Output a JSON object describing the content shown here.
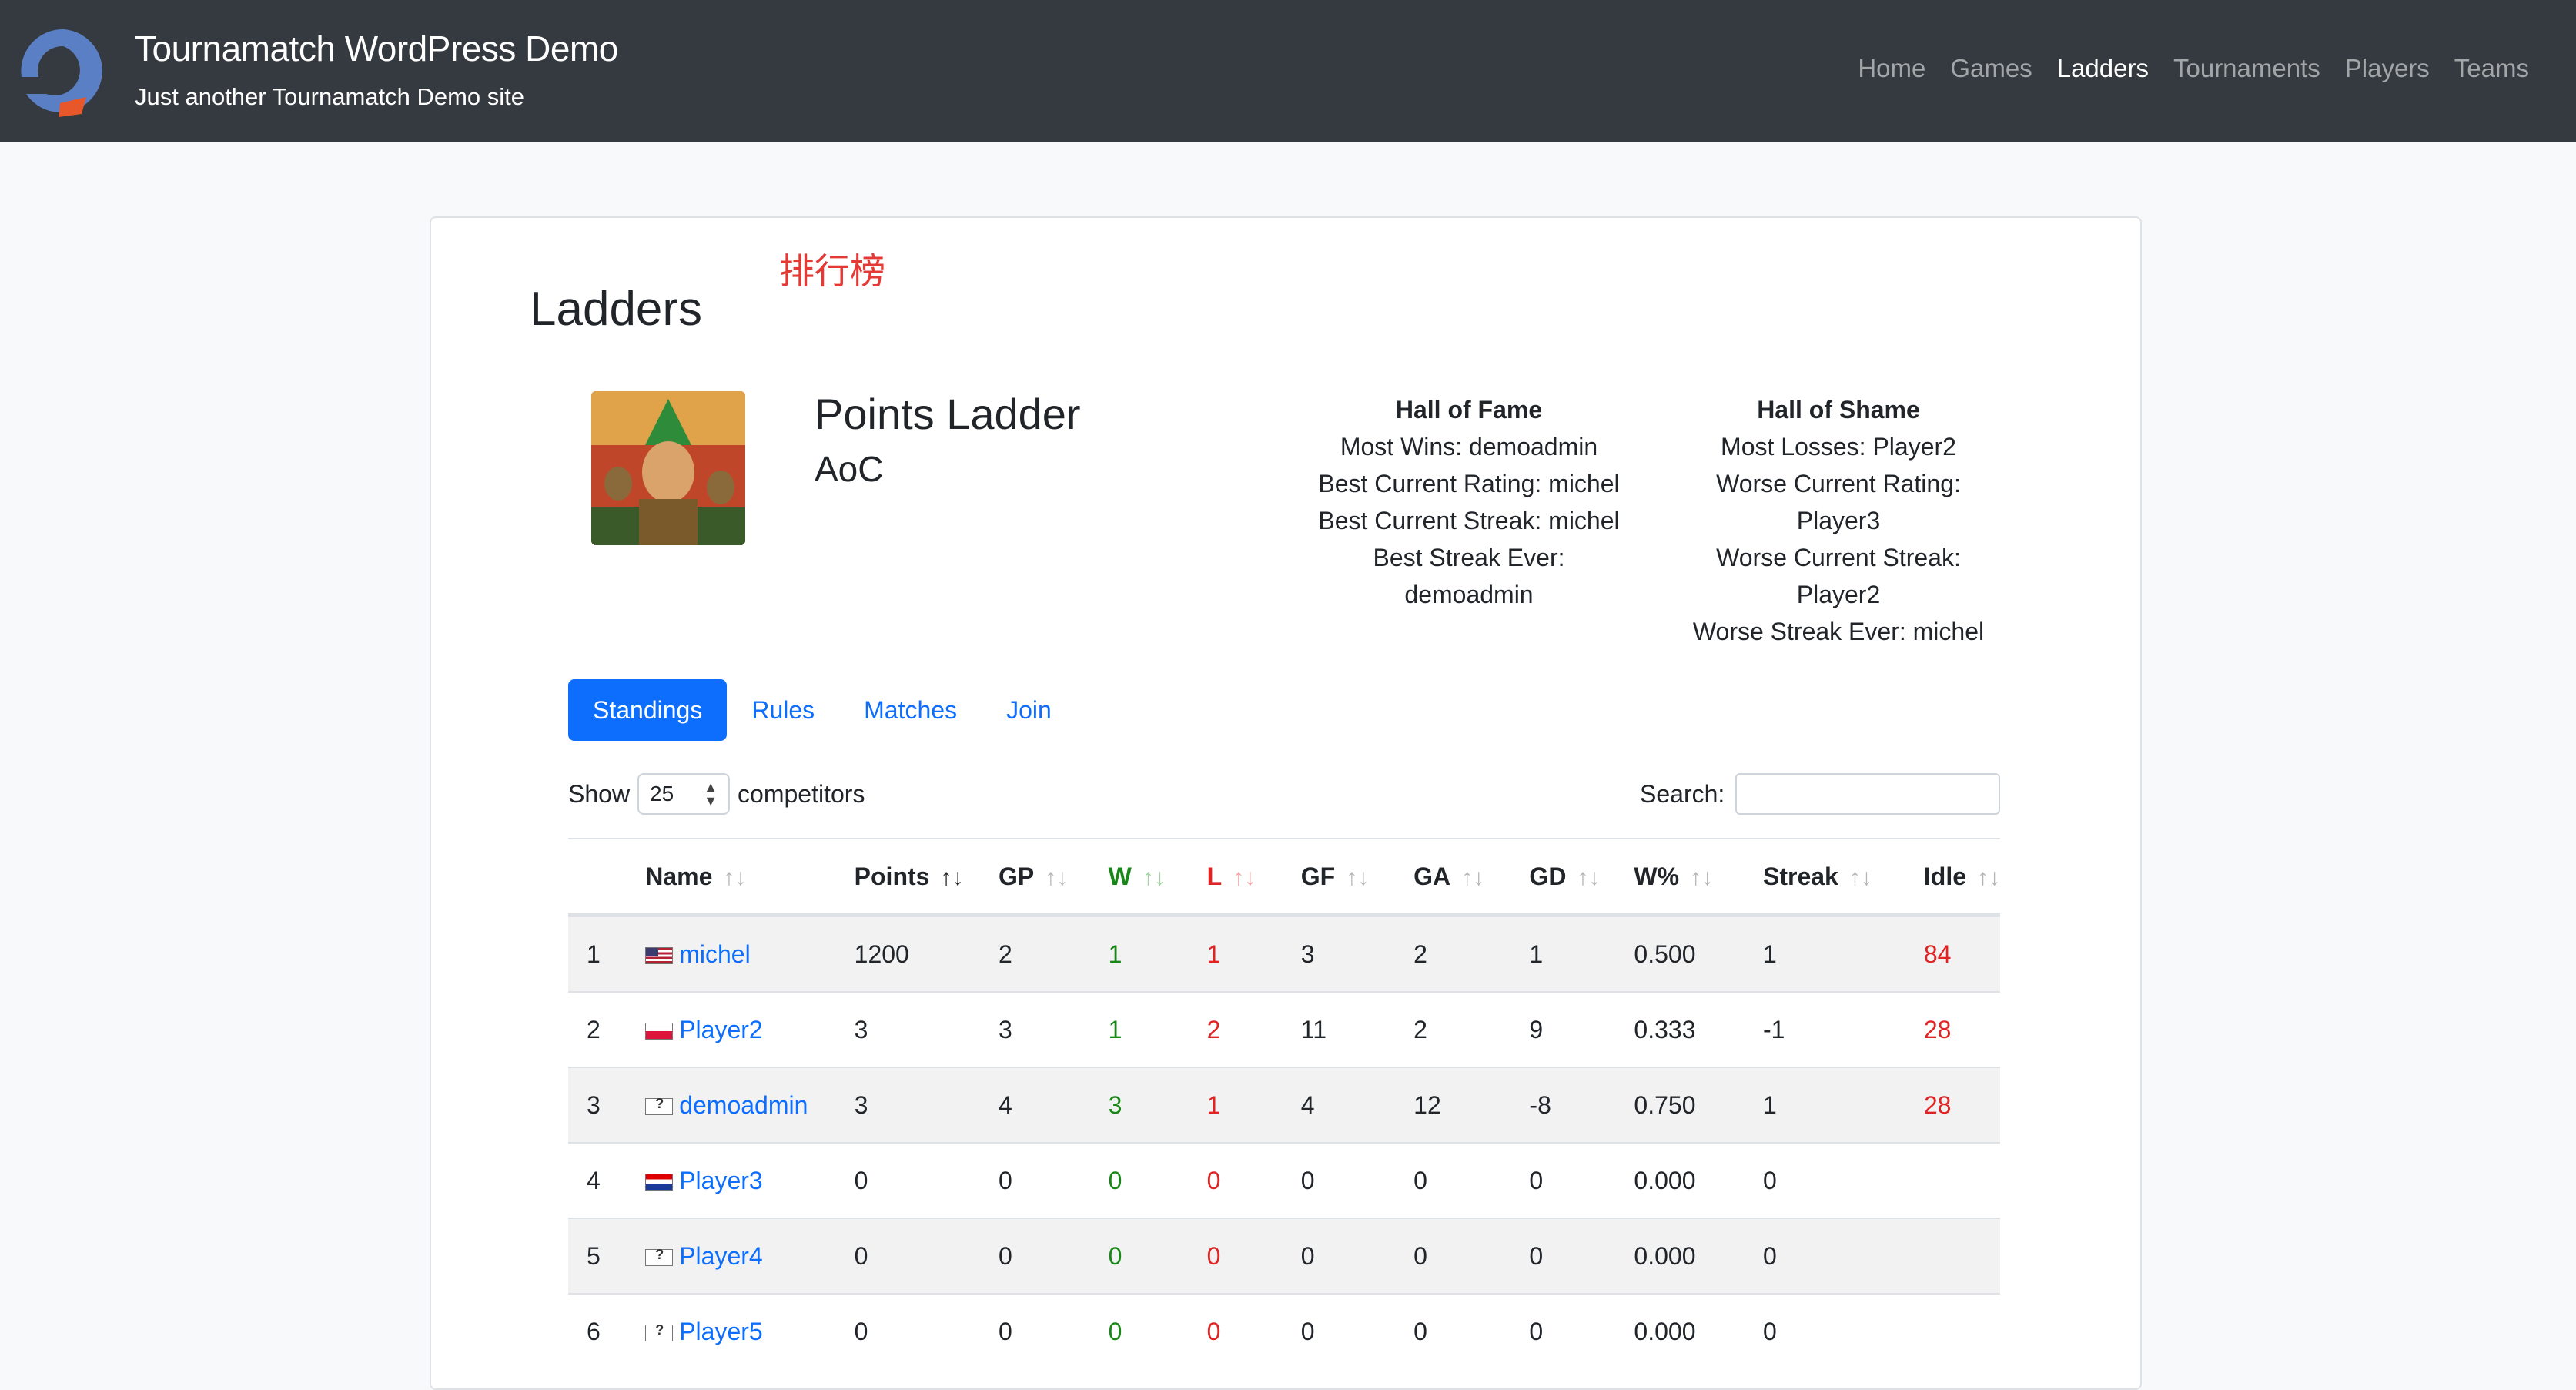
{
  "header": {
    "site_title": "Tournamatch WordPress Demo",
    "tagline": "Just another Tournamatch Demo site",
    "nav": [
      "Home",
      "Games",
      "Ladders",
      "Tournaments",
      "Players",
      "Teams"
    ],
    "active_nav": "Ladders",
    "colors": {
      "bar": "#343a40",
      "logo_blue": "#5b7fc4",
      "logo_orange": "#e8572a"
    }
  },
  "page": {
    "title": "Ladders",
    "annotation": "排行榜"
  },
  "ladder": {
    "name": "Points Ladder",
    "game": "AoC"
  },
  "hall_of_fame": {
    "heading": "Hall of Fame",
    "lines": [
      "Most Wins: demoadmin",
      "Best Current Rating: michel",
      "Best Current Streak: michel",
      "Best Streak Ever:",
      "demoadmin"
    ]
  },
  "hall_of_shame": {
    "heading": "Hall of Shame",
    "lines": [
      "Most Losses: Player2",
      "Worse Current Rating:",
      "Player3",
      "Worse Current Streak:",
      "Player2",
      "Worse Streak Ever: michel"
    ]
  },
  "tabs": [
    "Standings",
    "Rules",
    "Matches",
    "Join"
  ],
  "active_tab": "Standings",
  "controls": {
    "show_label": "Show",
    "page_size": "25",
    "competitors_label": "competitors",
    "search_label": "Search:",
    "search_value": ""
  },
  "table": {
    "columns": [
      "",
      "Name",
      "Points",
      "GP",
      "W",
      "L",
      "GF",
      "GA",
      "GD",
      "W%",
      "Streak",
      "Idle"
    ],
    "sort_glyph": "↑↓",
    "rows": [
      {
        "rank": "1",
        "flag": "us",
        "name": "michel",
        "points": "1200",
        "gp": "2",
        "w": "1",
        "l": "1",
        "gf": "3",
        "ga": "2",
        "gd": "1",
        "wpct": "0.500",
        "streak": "1",
        "idle": "84"
      },
      {
        "rank": "2",
        "flag": "pl",
        "name": "Player2",
        "points": "3",
        "gp": "3",
        "w": "1",
        "l": "2",
        "gf": "11",
        "ga": "2",
        "gd": "9",
        "wpct": "0.333",
        "streak": "-1",
        "idle": "28"
      },
      {
        "rank": "3",
        "flag": "unknown",
        "name": "demoadmin",
        "points": "3",
        "gp": "4",
        "w": "3",
        "l": "1",
        "gf": "4",
        "ga": "12",
        "gd": "-8",
        "wpct": "0.750",
        "streak": "1",
        "idle": "28"
      },
      {
        "rank": "4",
        "flag": "hr",
        "name": "Player3",
        "points": "0",
        "gp": "0",
        "w": "0",
        "l": "0",
        "gf": "0",
        "ga": "0",
        "gd": "0",
        "wpct": "0.000",
        "streak": "0",
        "idle": ""
      },
      {
        "rank": "5",
        "flag": "unknown",
        "name": "Player4",
        "points": "0",
        "gp": "0",
        "w": "0",
        "l": "0",
        "gf": "0",
        "ga": "0",
        "gd": "0",
        "wpct": "0.000",
        "streak": "0",
        "idle": ""
      },
      {
        "rank": "6",
        "flag": "unknown",
        "name": "Player5",
        "points": "0",
        "gp": "0",
        "w": "0",
        "l": "0",
        "gf": "0",
        "ga": "0",
        "gd": "0",
        "wpct": "0.000",
        "streak": "0",
        "idle": ""
      }
    ]
  }
}
